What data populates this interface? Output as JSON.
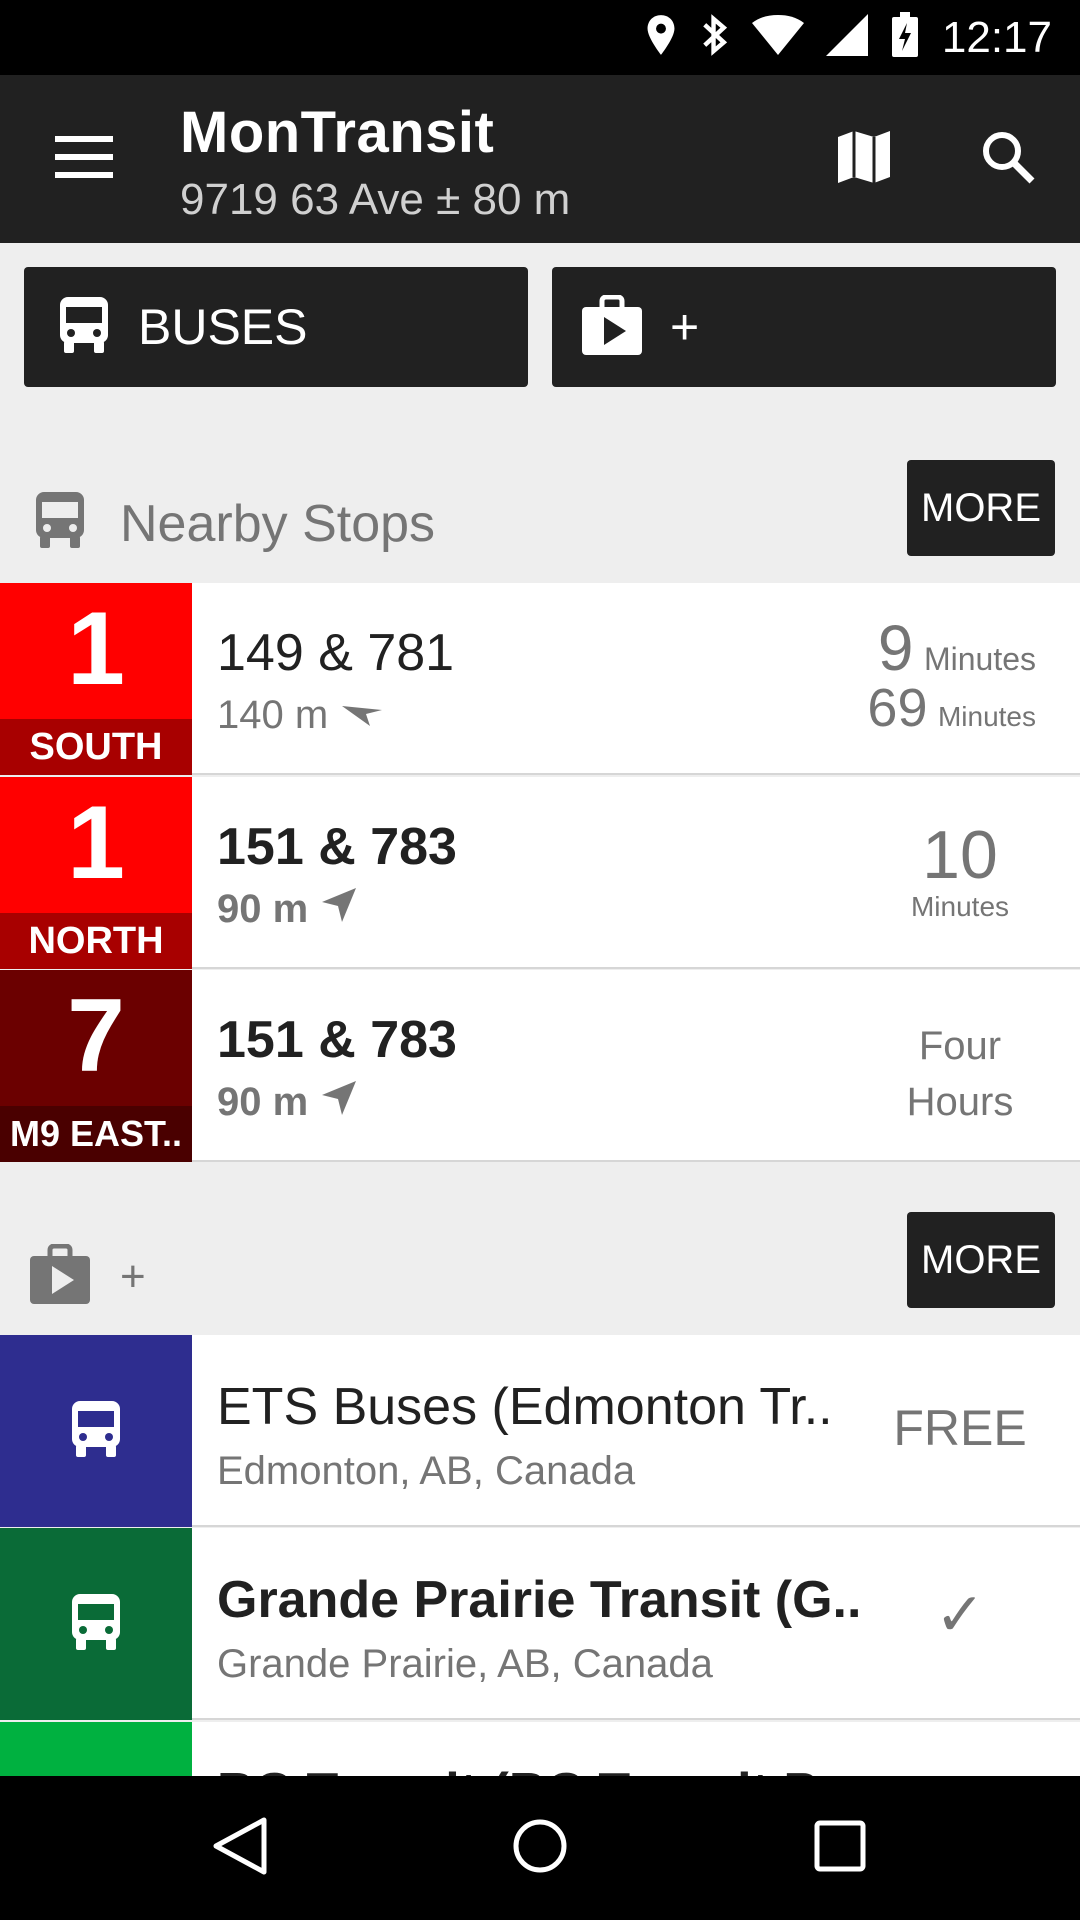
{
  "status_bar": {
    "time": "12:17",
    "icons": [
      "location-icon",
      "bluetooth-icon",
      "wifi-icon",
      "signal-icon",
      "battery-charging-icon"
    ]
  },
  "app_bar": {
    "title": "MonTransit",
    "subtitle": "9719 63 Ave ± 80 m",
    "icons": [
      "menu-icon",
      "map-icon",
      "search-icon"
    ]
  },
  "chips": {
    "buses": "BUSES",
    "add": "+"
  },
  "nearby": {
    "title": "Nearby Stops",
    "more": "MORE",
    "rows": [
      {
        "route": "1",
        "direction": "SOUTH",
        "color": "#ff0000",
        "dir_color": "#a80000",
        "stop": "149 & 781",
        "distance": "140 m",
        "times": [
          {
            "value": "9",
            "unit": "Minutes"
          },
          {
            "value": "69",
            "unit": "Minutes"
          }
        ]
      },
      {
        "route": "1",
        "direction": "NORTH",
        "color": "#ff0000",
        "dir_color": "#a80000",
        "stop": "151 & 783",
        "distance": "90 m",
        "time_value": "10",
        "time_unit": "Minutes"
      },
      {
        "route": "7",
        "direction": "M9 EAST..",
        "color": "#6b0000",
        "dir_color": "#4a0000",
        "stop": "151 & 783",
        "distance": "90 m",
        "time_text_1": "Four",
        "time_text_2": "Hours"
      }
    ]
  },
  "agencies": {
    "title": "+",
    "more": "MORE",
    "rows": [
      {
        "name": "ETS Buses (Edmonton Tr..",
        "location": "Edmonton, AB, Canada",
        "status": "FREE",
        "color": "#2e2d8f"
      },
      {
        "name": "Grande Prairie Transit (G..",
        "location": "Grande Prairie, AB, Canada",
        "status": "✓",
        "color": "#0a6b37"
      },
      {
        "name": "BC Transit (BC Transit P..",
        "color": "#00b140"
      }
    ]
  }
}
